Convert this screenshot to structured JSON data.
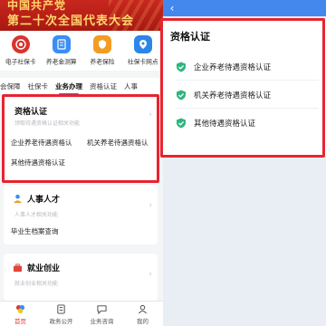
{
  "left": {
    "banner": {
      "line1": "中国共产党",
      "line2": "第二十次全国代表大会"
    },
    "quick_icons": [
      {
        "label": "电子社保卡",
        "icon": "social-card-icon"
      },
      {
        "label": "养老金测算",
        "icon": "calculator-icon"
      },
      {
        "label": "养老保险",
        "icon": "pension-icon"
      },
      {
        "label": "社保卡网点",
        "icon": "outlet-icon"
      }
    ],
    "tabs": [
      "会保障",
      "社保卡",
      "业务办理",
      "资格认证",
      "人事"
    ],
    "active_tab": "业务办理",
    "qualification_card": {
      "title": "资格认证",
      "subtitle": "领取待遇资格认证相关功能",
      "items": [
        "企业养老待遇资格认",
        "机关养老待遇资格认",
        "其他待遇资格认证"
      ]
    },
    "hr_card": {
      "title": "人事人才",
      "subtitle": "人事人才相关功能",
      "items": [
        "毕业生档案查询"
      ]
    },
    "employment_card": {
      "title": "就业创业",
      "subtitle": "就业创业相关功能"
    },
    "bottom_nav": [
      {
        "label": "首页",
        "icon": "home-icon",
        "active": true
      },
      {
        "label": "政务公开",
        "icon": "document-icon",
        "active": false
      },
      {
        "label": "业务咨询",
        "icon": "chat-icon",
        "active": false
      },
      {
        "label": "我的",
        "icon": "user-icon",
        "active": false
      }
    ]
  },
  "right": {
    "panel_title": "资格认证",
    "items": [
      {
        "label": "企业养老待遇资格认证",
        "icon": "shield-check-icon"
      },
      {
        "label": "机关养老待遇资格认证",
        "icon": "shield-check-icon"
      },
      {
        "label": "其他待遇资格认证",
        "icon": "shield-check-icon"
      }
    ]
  },
  "colors": {
    "banner_red": "#c8271e",
    "highlight_red": "#e8242f",
    "primary_blue": "#4488ee",
    "shield_green": "#2fb57d",
    "tab_underline": "#1f6fe5"
  }
}
